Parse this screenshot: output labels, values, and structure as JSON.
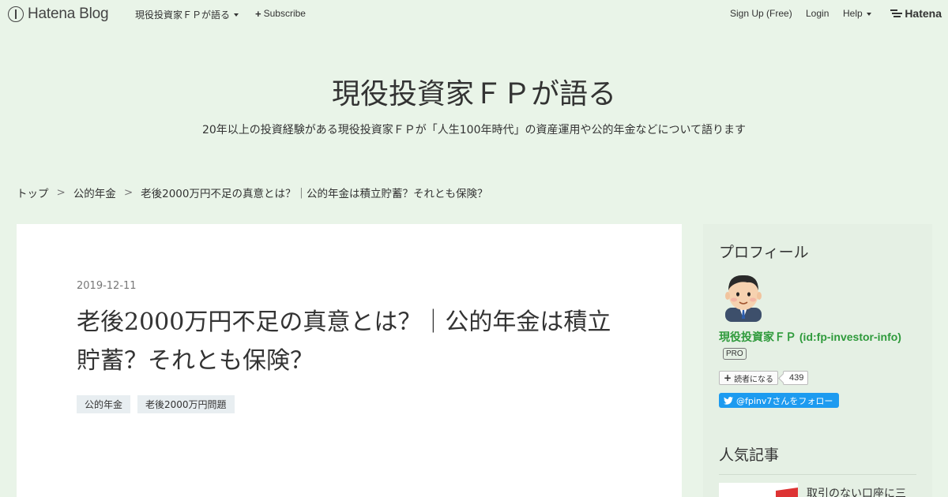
{
  "globalbar": {
    "logo_text": "Hatena Blog",
    "blog_menu_label": "現役投資家ＦＰが語る",
    "subscribe_label": "Subscribe",
    "signup_label": "Sign Up (Free)",
    "login_label": "Login",
    "help_label": "Help",
    "brand_text": "Hatena"
  },
  "header": {
    "title": "現役投資家ＦＰが語る",
    "description": "20年以上の投資経験がある現役投資家ＦＰが「人生100年時代」の資産運用や公的年金などについて語ります"
  },
  "breadcrumb": {
    "items": [
      "トップ",
      "公的年金",
      "老後2000万円不足の真意とは？｜公的年金は積立貯蓄？それとも保険？"
    ],
    "separator": ">"
  },
  "entry": {
    "date": "2019-12-11",
    "title": "老後2000万円不足の真意とは？｜公的年金は積立貯蓄？それとも保険？",
    "categories": [
      "公的年金",
      "老後2000万円問題"
    ]
  },
  "sidebar": {
    "profile_heading": "プロフィール",
    "profile_name": "現役投資家ＦＰ (id:fp-investor-info)",
    "pro_badge": "PRO",
    "subscribe_label": "読者になる",
    "subscriber_count": "439",
    "twitter_label": "@fpinv7さんをフォロー",
    "popular_heading": "人気記事",
    "popular_first_title": "取引のない口座に三"
  },
  "colors": {
    "page_bg": "#e9f4e8",
    "sidebar_bg": "#e5f0e4",
    "profile_link": "#2e9a3b",
    "twitter_blue": "#1d9bf0"
  }
}
